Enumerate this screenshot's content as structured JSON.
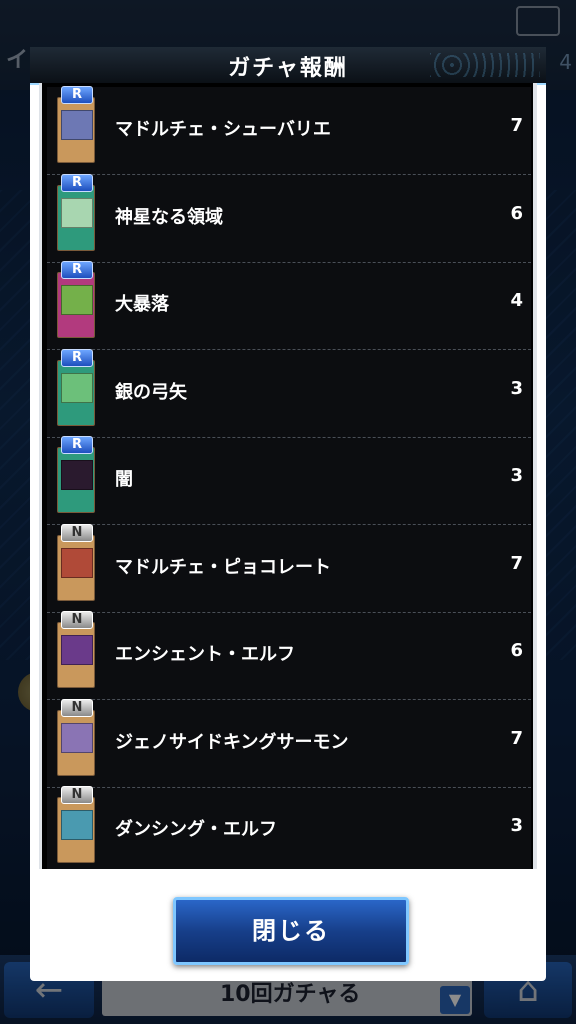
{
  "background": {
    "title": "イベント",
    "right_number": "4",
    "gacha_button_label": "10回ガチャる"
  },
  "modal": {
    "title": "ガチャ報酬",
    "close_label": "閉じる",
    "items": [
      {
        "rarity": "R",
        "name": "マドルチェ・シューバリエ",
        "count": "7",
        "card_color": "#c9985c",
        "art_color": "#6d78b4"
      },
      {
        "rarity": "R",
        "name": "神星なる領域",
        "count": "6",
        "card_color": "#2e9a7c",
        "art_color": "#a8d6b0"
      },
      {
        "rarity": "R",
        "name": "大暴落",
        "count": "4",
        "card_color": "#b23a7e",
        "art_color": "#74b04a"
      },
      {
        "rarity": "R",
        "name": "銀の弓矢",
        "count": "3",
        "card_color": "#2e9a7c",
        "art_color": "#6cc07a"
      },
      {
        "rarity": "R",
        "name": "闇",
        "count": "3",
        "card_color": "#2e9a7c",
        "art_color": "#2a1a2e"
      },
      {
        "rarity": "N",
        "name": "マドルチェ・ピョコレート",
        "count": "7",
        "card_color": "#c9985c",
        "art_color": "#b04a38"
      },
      {
        "rarity": "N",
        "name": "エンシェント・エルフ",
        "count": "6",
        "card_color": "#c9985c",
        "art_color": "#6a3a8a"
      },
      {
        "rarity": "N",
        "name": "ジェノサイドキングサーモン",
        "count": "7",
        "card_color": "#c9985c",
        "art_color": "#8a74b4"
      },
      {
        "rarity": "N",
        "name": "ダンシング・エルフ",
        "count": "3",
        "card_color": "#c9985c",
        "art_color": "#4a9ab0"
      }
    ]
  }
}
